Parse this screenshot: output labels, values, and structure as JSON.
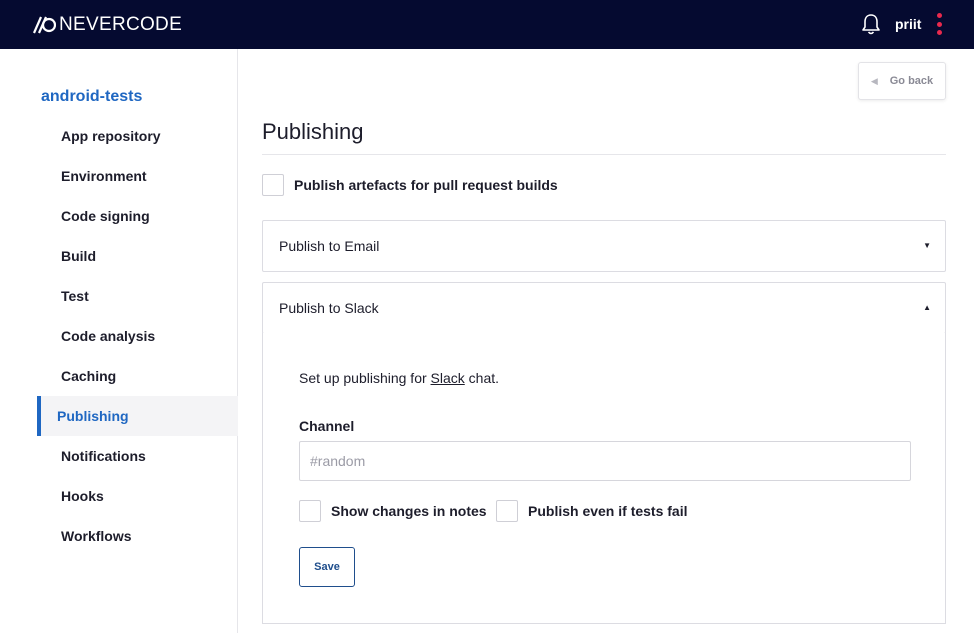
{
  "brand": {
    "name": "NEVERCODE"
  },
  "header": {
    "username": "priit",
    "icons": [
      "bell-icon",
      "kebab-menu-icon"
    ],
    "accent": "#e8294d",
    "background": "#050a30"
  },
  "sidebar": {
    "project": "android-tests",
    "items": [
      {
        "label": "App repository"
      },
      {
        "label": "Environment"
      },
      {
        "label": "Code signing"
      },
      {
        "label": "Build"
      },
      {
        "label": "Test"
      },
      {
        "label": "Code analysis"
      },
      {
        "label": "Caching"
      },
      {
        "label": "Publishing",
        "active": true
      },
      {
        "label": "Notifications"
      },
      {
        "label": "Hooks"
      },
      {
        "label": "Workflows"
      }
    ],
    "active_color": "#1f67c2"
  },
  "main": {
    "go_back": "Go back",
    "title": "Publishing",
    "pr_checkbox_label": "Publish artefacts for pull request builds",
    "email_panel": {
      "title": "Publish to Email",
      "expanded": false
    },
    "slack_panel": {
      "title": "Publish to Slack",
      "expanded": true,
      "intro_before": "Set up publishing for ",
      "intro_link": "Slack",
      "intro_after": " chat.",
      "channel_label": "Channel",
      "channel_value": "",
      "channel_placeholder": "#random",
      "show_changes_label": "Show changes in notes",
      "publish_fail_label": "Publish even if tests fail",
      "save_label": "Save"
    }
  }
}
